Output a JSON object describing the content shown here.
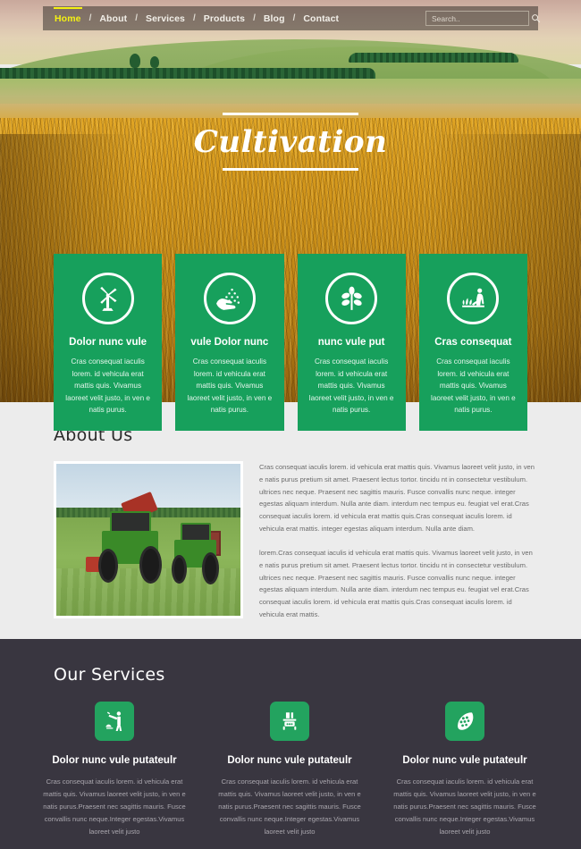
{
  "nav": {
    "items": [
      {
        "label": "Home",
        "active": true
      },
      {
        "label": "About",
        "active": false
      },
      {
        "label": "Services",
        "active": false
      },
      {
        "label": "Products",
        "active": false
      },
      {
        "label": "Blog",
        "active": false
      },
      {
        "label": "Contact",
        "active": false
      }
    ],
    "separator": "/"
  },
  "search": {
    "placeholder": "Search..",
    "value": "",
    "icon": "search-icon"
  },
  "hero": {
    "title": "Cultivation"
  },
  "feature_cards": [
    {
      "icon": "windmill-icon",
      "title": "Dolor nunc vule",
      "text": "Cras consequat iaculis lorem. id vehicula erat mattis quis. Vivamus laoreet velit justo, in ven e natis purus."
    },
    {
      "icon": "hand-seeds-icon",
      "title": "vule Dolor nunc",
      "text": "Cras consequat iaculis lorem. id vehicula erat mattis quis. Vivamus laoreet velit justo, in ven e natis purus."
    },
    {
      "icon": "plant-leaves-icon",
      "title": "nunc vule put",
      "text": "Cras consequat iaculis lorem. id vehicula erat mattis quis. Vivamus laoreet velit justo, in ven e natis purus."
    },
    {
      "icon": "farmer-planting-icon",
      "title": "Cras consequat",
      "text": "Cras consequat iaculis lorem. id vehicula erat mattis quis. Vivamus laoreet velit justo, in ven e natis purus."
    }
  ],
  "about": {
    "title": "About Us",
    "image_alt": "two-green-tractors-in-field-photo",
    "paragraphs": [
      "Cras consequat iaculis lorem. id vehicula erat mattis quis. Vivamus laoreet velit justo, in ven e natis purus pretium sit amet. Praesent lectus tortor. tincidu nt in consectetur vestibulum. ultrices nec neque. Praesent nec sagittis mauris. Fusce convallis nunc neque. integer egestas aliquam interdum. Nulla ante diam. interdum nec tempus eu. feugiat vel erat.Cras consequat iaculis lorem. id vehicula erat mattis quis.Cras consequat iaculis lorem. id vehicula erat mattis. integer egestas aliquam interdum. Nulla ante diam.",
      "lorem.Cras consequat iaculis id vehicula erat mattis quis. Vivamus laoreet velit justo, in ven e natis purus pretium sit amet. Praesent lectus tortor. tincidu nt in consectetur vestibulum. ultrices nec neque. Praesent nec sagittis mauris. Fusce convallis nunc neque. integer egestas aliquam interdum. Nulla ante diam. interdum nec tempus eu. feugiat vel erat.Cras consequat iaculis lorem. id vehicula erat mattis quis.Cras consequat iaculis lorem. id vehicula erat mattis."
    ]
  },
  "services": {
    "title": "Our Services",
    "items": [
      {
        "icon": "farmer-hoe-icon",
        "title": "Dolor nunc vule putateulr",
        "text": "Cras consequat iaculis lorem. id vehicula erat mattis quis. Vivamus laoreet velit justo, in ven e natis purus.Praesent nec sagittis mauris. Fusce convallis nunc neque.Integer egestas.Vivamus laoreet velit justo"
      },
      {
        "icon": "tractor-icon",
        "title": "Dolor nunc vule putateulr",
        "text": "Cras consequat iaculis lorem. id vehicula erat mattis quis. Vivamus laoreet velit justo, in ven e natis purus.Praesent nec sagittis mauris. Fusce convallis nunc neque.Integer egestas.Vivamus laoreet velit justo"
      },
      {
        "icon": "hops-grain-icon",
        "title": "Dolor nunc vule putateulr",
        "text": "Cras consequat iaculis lorem. id vehicula erat mattis quis. Vivamus laoreet velit justo, in ven e natis purus.Praesent nec sagittis mauris. Fusce convallis nunc neque.Integer egestas.Vivamus laoreet velit justo"
      }
    ]
  },
  "colors": {
    "brand_green": "#17a05c",
    "service_green": "#23a35f",
    "dark_section": "#393640",
    "light_section": "#ececec",
    "nav_active": "#f5f113"
  }
}
